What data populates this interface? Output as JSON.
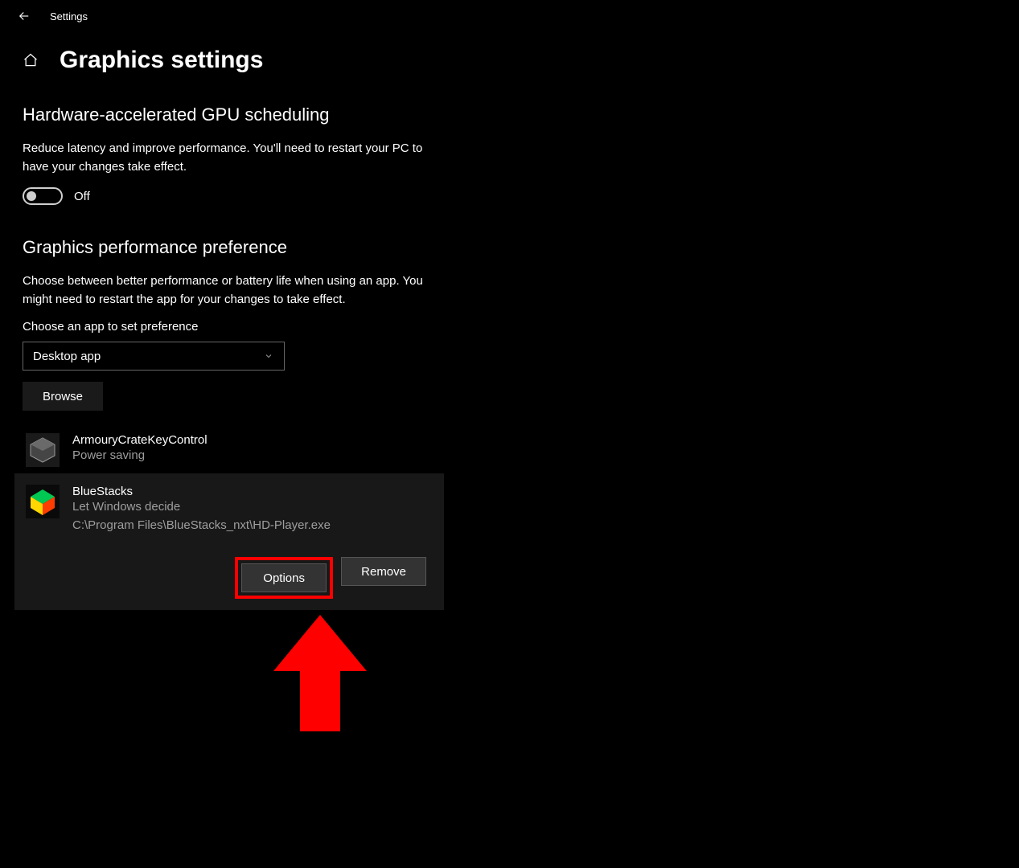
{
  "titlebar": {
    "label": "Settings"
  },
  "page": {
    "title": "Graphics settings"
  },
  "gpu_section": {
    "title": "Hardware-accelerated GPU scheduling",
    "desc": "Reduce latency and improve performance. You'll need to restart your PC to have your changes take effect.",
    "toggle_state_label": "Off"
  },
  "perf_section": {
    "title": "Graphics performance preference",
    "desc": "Choose between better performance or battery life when using an app. You might need to restart the app for your changes to take effect.",
    "choose_label": "Choose an app to set preference",
    "dropdown_value": "Desktop app",
    "browse_label": "Browse"
  },
  "apps": [
    {
      "name": "ArmouryCrateKeyControl",
      "status": "Power saving",
      "path": ""
    },
    {
      "name": "BlueStacks",
      "status": "Let Windows decide",
      "path": "C:\\Program Files\\BlueStacks_nxt\\HD-Player.exe"
    }
  ],
  "actions": {
    "options": "Options",
    "remove": "Remove"
  },
  "colors": {
    "highlight": "#ff0000"
  }
}
